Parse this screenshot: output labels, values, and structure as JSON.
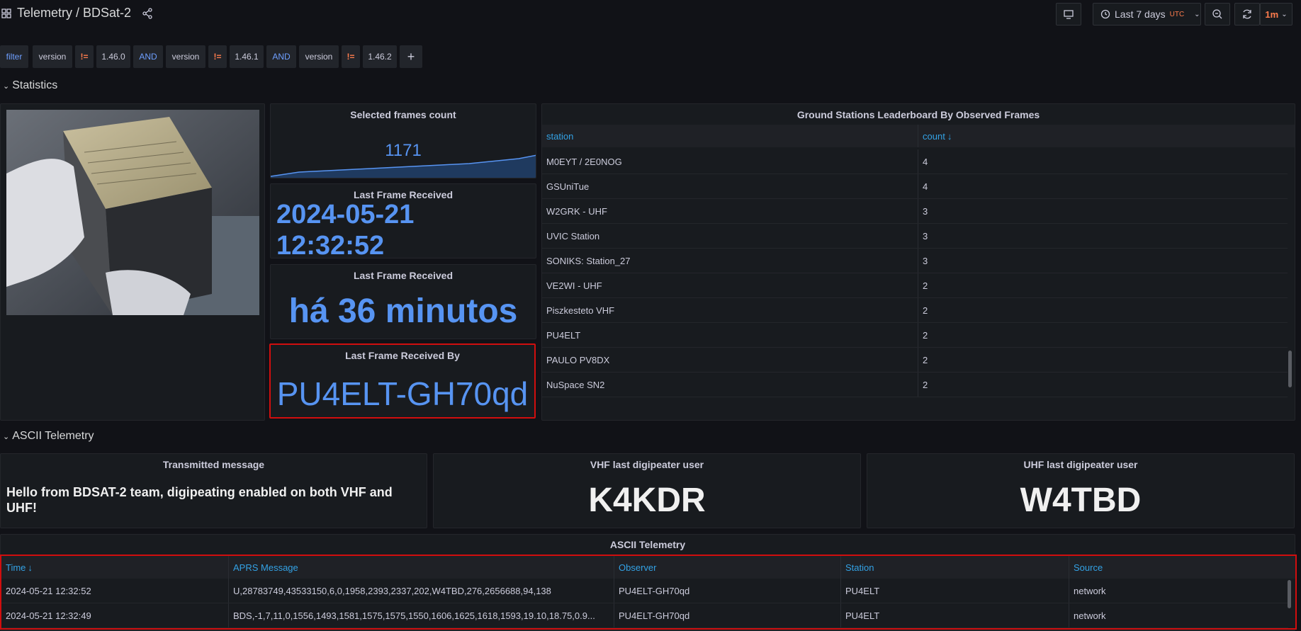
{
  "header": {
    "breadcrumb": "Telemetry / BDSat-2",
    "time_range": "Last 7 days",
    "timezone": "UTC",
    "refresh": "1m"
  },
  "filter": {
    "label": "filter",
    "items": [
      {
        "key": "version",
        "op": "!=",
        "value": "1.46.0"
      },
      {
        "conj": "AND"
      },
      {
        "key": "version",
        "op": "!=",
        "value": "1.46.1"
      },
      {
        "conj": "AND"
      },
      {
        "key": "version",
        "op": "!=",
        "value": "1.46.2"
      }
    ],
    "add": "+"
  },
  "sections": {
    "statistics": "Statistics",
    "ascii": "ASCII Telemetry"
  },
  "stats": {
    "frames_title": "Selected frames count",
    "frames_value": "1171",
    "last_frame_title": "Last Frame Received",
    "last_frame_value_line1": "2024-05-21",
    "last_frame_value_line2": "12:32:52",
    "last_frame_rel_title": "Last Frame Received",
    "last_frame_rel_value": "há 36 minutos",
    "last_by_title": "Last Frame Received By",
    "last_by_value": "PU4ELT-GH70qd"
  },
  "leaderboard": {
    "title": "Ground Stations Leaderboard By Observed Frames",
    "col_station": "station",
    "col_count": "count",
    "rows": [
      {
        "station": "M0EYT / 2E0NOG",
        "count": "4"
      },
      {
        "station": "GSUniTue",
        "count": "4"
      },
      {
        "station": "W2GRK - UHF",
        "count": "3"
      },
      {
        "station": "UVIC Station",
        "count": "3"
      },
      {
        "station": "SONIKS: Station_27",
        "count": "3"
      },
      {
        "station": "VE2WI - UHF",
        "count": "2"
      },
      {
        "station": "Piszkesteto VHF",
        "count": "2"
      },
      {
        "station": "PU4ELT",
        "count": "2"
      },
      {
        "station": "PAULO PV8DX",
        "count": "2"
      },
      {
        "station": "NuSpace SN2",
        "count": "2"
      }
    ]
  },
  "ascii": {
    "msg_title": "Transmitted message",
    "msg_value": "Hello from BDSAT-2 team, digipeating enabled on both VHF and UHF!",
    "vhf_title": "VHF last digipeater user",
    "vhf_value": "K4KDR",
    "uhf_title": "UHF last digipeater user",
    "uhf_value": "W4TBD",
    "table_title": "ASCII Telemetry",
    "cols": [
      "Time",
      "APRS Message",
      "Observer",
      "Station",
      "Source"
    ],
    "rows": [
      [
        "2024-05-21 12:32:52",
        "U,28783749,43533150,6,0,1958,2393,2337,202,W4TBD,276,2656688,94,138",
        "PU4ELT-GH70qd",
        "PU4ELT",
        "network"
      ],
      [
        "2024-05-21 12:32:49",
        "BDS,-1,7,11,0,1556,1493,1581,1575,1575,1550,1606,1625,1618,1593,19.10,18.75,0.9...",
        "PU4ELT-GH70qd",
        "PU4ELT",
        "network"
      ]
    ]
  },
  "colors": {
    "accent": "#5794f2",
    "link": "#33a2e5",
    "highlight": "#d10e0e",
    "refresh": "#ff7c4d"
  }
}
